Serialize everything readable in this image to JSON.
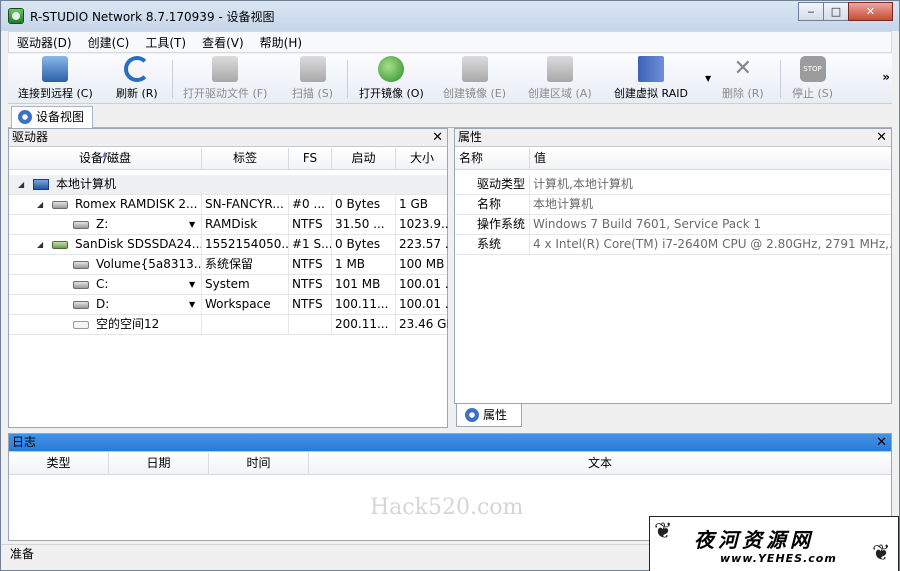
{
  "window": {
    "title": "R-STUDIO Network 8.7.170939 - 设备视图"
  },
  "window_buttons": {
    "minimize": "‒",
    "maximize": "□",
    "close": "✕"
  },
  "menu": [
    "驱动器(D)",
    "创建(C)",
    "工具(T)",
    "查看(V)",
    "帮助(H)"
  ],
  "toolbar": {
    "buttons": [
      {
        "label": "连接到远程 (C)",
        "icon": "remote-connect-icon",
        "enabled": true
      },
      {
        "label": "刷新 (R)",
        "icon": "refresh-icon",
        "enabled": true
      },
      {
        "label": "打开驱动文件 (F)",
        "icon": "open-drive-files-icon",
        "enabled": false
      },
      {
        "label": "扫描 (S)",
        "icon": "scan-icon",
        "enabled": false
      },
      {
        "label": "打开镜像 (O)",
        "icon": "open-image-icon",
        "enabled": true
      },
      {
        "label": "创建镜像 (E)",
        "icon": "create-image-icon",
        "enabled": false
      },
      {
        "label": "创建区域 (A)",
        "icon": "create-region-icon",
        "enabled": false
      },
      {
        "label": "创建虚拟 RAID",
        "icon": "create-virtual-raid-icon",
        "enabled": true
      },
      {
        "label": "删除 (R)",
        "icon": "delete-icon",
        "enabled": false
      },
      {
        "label": "停止 (S)",
        "icon": "stop-icon",
        "enabled": false
      }
    ],
    "more": "»",
    "stop_icon_text": "STOP"
  },
  "tabs": {
    "device_view": "设备视图"
  },
  "drives_panel": {
    "title": "驱动器",
    "close": "✕",
    "columns": [
      "设备/磁盘",
      "标签",
      "FS",
      "启动",
      "大小"
    ],
    "rows": [
      {
        "name": "本地计算机",
        "label": "",
        "fs": "",
        "start": "",
        "size": ""
      },
      {
        "name": "Romex RAMDISK 2...",
        "label": "SN-FANCYR...",
        "fs": "#0 ...",
        "start": "0 Bytes",
        "size": "1 GB"
      },
      {
        "name": "Z:",
        "label": "RAMDisk",
        "fs": "NTFS",
        "start": "31.50 ...",
        "size": "1023.9..."
      },
      {
        "name": "SanDisk SDSSDA24...",
        "label": "1552154050...",
        "fs": "#1 S...",
        "start": "0 Bytes",
        "size": "223.57 ..."
      },
      {
        "name": "Volume{5a8313...",
        "label": "系统保留",
        "fs": "NTFS",
        "start": "1 MB",
        "size": "100 MB"
      },
      {
        "name": "C:",
        "label": "System",
        "fs": "NTFS",
        "start": "101 MB",
        "size": "100.01 ..."
      },
      {
        "name": "D:",
        "label": "Workspace",
        "fs": "NTFS",
        "start": "100.11...",
        "size": "100.01 ..."
      },
      {
        "name": "空的空间12",
        "label": "",
        "fs": "",
        "start": "200.11...",
        "size": "23.46 GB"
      }
    ]
  },
  "properties_panel": {
    "title": "属性",
    "close": "✕",
    "columns": [
      "名称",
      "值"
    ],
    "rows": [
      {
        "name": "驱动类型",
        "value": "计算机,本地计算机"
      },
      {
        "name": "名称",
        "value": "本地计算机"
      },
      {
        "name": "操作系统",
        "value": "Windows 7 Build 7601, Service Pack 1"
      },
      {
        "name": "系统",
        "value": "4 x Intel(R) Core(TM) i7-2640M CPU @ 2.80GHz, 2791 MHz,..."
      }
    ],
    "tab": "属性"
  },
  "log_panel": {
    "title": "日志",
    "close": "✕",
    "columns": [
      "类型",
      "日期",
      "时间",
      "文本"
    ]
  },
  "status": "准备",
  "watermark": "Hack520.com",
  "logo": {
    "text": "夜河资源网",
    "url": "www.YEHES.com"
  }
}
